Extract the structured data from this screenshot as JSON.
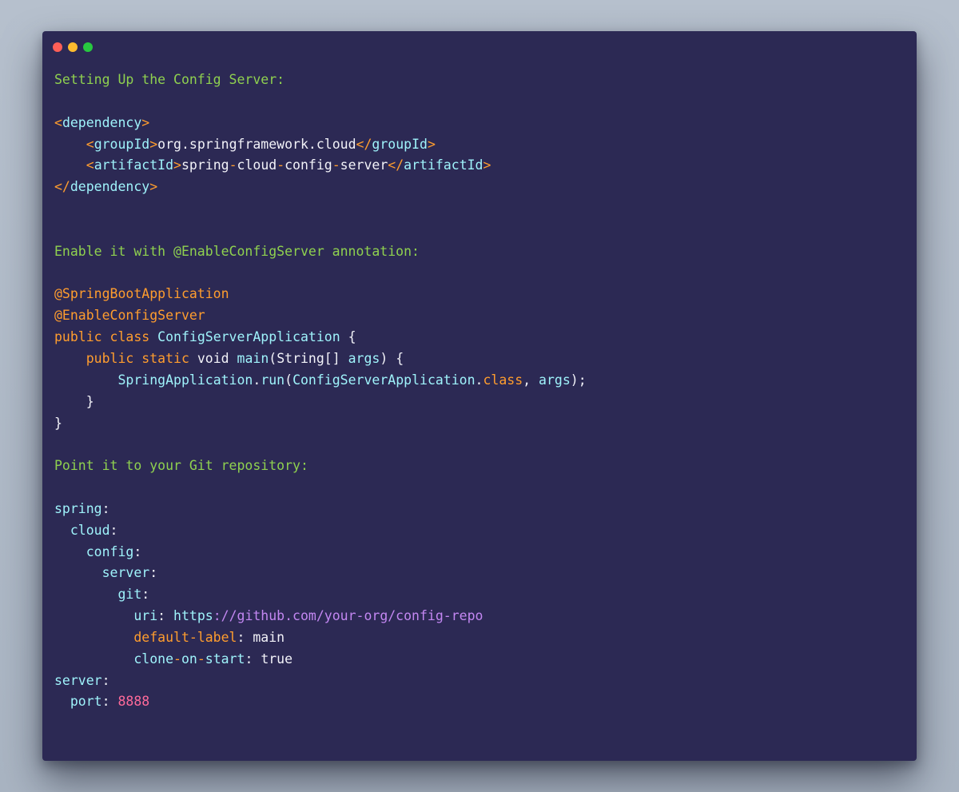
{
  "colors": {
    "background": "#aeb8c6",
    "window": "#2c2954",
    "close_dot": "#ff5f57",
    "minimize_dot": "#febc2e",
    "maximize_dot": "#28c840",
    "comment": "#8fd14f",
    "keyword": "#ff9d2e",
    "identifier": "#9ff3fb",
    "string": "#c387f2",
    "number": "#ff6a9a",
    "plain": "#f2f2f8"
  },
  "window_controls": [
    "close",
    "minimize",
    "maximize"
  ],
  "code_lines": [
    [
      {
        "t": "Setting Up the Config Server:",
        "c": "green"
      }
    ],
    [],
    [
      {
        "t": "<",
        "c": "orange"
      },
      {
        "t": "dependency",
        "c": "cyan"
      },
      {
        "t": ">",
        "c": "orange"
      }
    ],
    [
      {
        "t": "    "
      },
      {
        "t": "<",
        "c": "orange"
      },
      {
        "t": "groupId",
        "c": "cyan"
      },
      {
        "t": ">",
        "c": "orange"
      },
      {
        "t": "org.springframework.cloud",
        "c": "white"
      },
      {
        "t": "</",
        "c": "orange"
      },
      {
        "t": "groupId",
        "c": "cyan"
      },
      {
        "t": ">",
        "c": "orange"
      }
    ],
    [
      {
        "t": "    "
      },
      {
        "t": "<",
        "c": "orange"
      },
      {
        "t": "artifactId",
        "c": "cyan"
      },
      {
        "t": ">",
        "c": "orange"
      },
      {
        "t": "spring",
        "c": "white"
      },
      {
        "t": "-",
        "c": "orange"
      },
      {
        "t": "cloud",
        "c": "white"
      },
      {
        "t": "-",
        "c": "orange"
      },
      {
        "t": "config",
        "c": "white"
      },
      {
        "t": "-",
        "c": "orange"
      },
      {
        "t": "server",
        "c": "white"
      },
      {
        "t": "</",
        "c": "orange"
      },
      {
        "t": "artifactId",
        "c": "cyan"
      },
      {
        "t": ">",
        "c": "orange"
      }
    ],
    [
      {
        "t": "</",
        "c": "orange"
      },
      {
        "t": "dependency",
        "c": "cyan"
      },
      {
        "t": ">",
        "c": "orange"
      }
    ],
    [],
    [],
    [
      {
        "t": "Enable it with @EnableConfigServer annotation:",
        "c": "green"
      }
    ],
    [],
    [
      {
        "t": "@SpringBootApplication",
        "c": "orange"
      }
    ],
    [
      {
        "t": "@EnableConfigServer",
        "c": "orange"
      }
    ],
    [
      {
        "t": "public",
        "c": "orange"
      },
      {
        "t": " "
      },
      {
        "t": "class",
        "c": "orange"
      },
      {
        "t": " "
      },
      {
        "t": "ConfigServerApplication",
        "c": "cyan"
      },
      {
        "t": " {",
        "c": "white"
      }
    ],
    [
      {
        "t": "    "
      },
      {
        "t": "public",
        "c": "orange"
      },
      {
        "t": " "
      },
      {
        "t": "static",
        "c": "orange"
      },
      {
        "t": " void ",
        "c": "white"
      },
      {
        "t": "main",
        "c": "cyan"
      },
      {
        "t": "(String[] ",
        "c": "white"
      },
      {
        "t": "args",
        "c": "cyan"
      },
      {
        "t": ") {",
        "c": "white"
      }
    ],
    [
      {
        "t": "        "
      },
      {
        "t": "SpringApplication",
        "c": "cyan"
      },
      {
        "t": ".",
        "c": "white"
      },
      {
        "t": "run",
        "c": "cyan"
      },
      {
        "t": "(",
        "c": "white"
      },
      {
        "t": "ConfigServerApplication",
        "c": "cyan"
      },
      {
        "t": ".",
        "c": "white"
      },
      {
        "t": "class",
        "c": "orange"
      },
      {
        "t": ", ",
        "c": "white"
      },
      {
        "t": "args",
        "c": "cyan"
      },
      {
        "t": ");",
        "c": "white"
      }
    ],
    [
      {
        "t": "    "
      },
      {
        "t": "}",
        "c": "white"
      }
    ],
    [
      {
        "t": "}",
        "c": "white"
      }
    ],
    [],
    [
      {
        "t": "Point it to your Git repository:",
        "c": "green"
      }
    ],
    [],
    [
      {
        "t": "spring",
        "c": "cyan"
      },
      {
        "t": ":",
        "c": "white"
      }
    ],
    [
      {
        "t": "  "
      },
      {
        "t": "cloud",
        "c": "cyan"
      },
      {
        "t": ":",
        "c": "white"
      }
    ],
    [
      {
        "t": "    "
      },
      {
        "t": "config",
        "c": "cyan"
      },
      {
        "t": ":",
        "c": "white"
      }
    ],
    [
      {
        "t": "      "
      },
      {
        "t": "server",
        "c": "cyan"
      },
      {
        "t": ":",
        "c": "white"
      }
    ],
    [
      {
        "t": "        "
      },
      {
        "t": "git",
        "c": "cyan"
      },
      {
        "t": ":",
        "c": "white"
      }
    ],
    [
      {
        "t": "          "
      },
      {
        "t": "uri",
        "c": "cyan"
      },
      {
        "t": ": ",
        "c": "white"
      },
      {
        "t": "https",
        "c": "cyan"
      },
      {
        "t": "://github.com/your-org/config-repo",
        "c": "purple"
      }
    ],
    [
      {
        "t": "          "
      },
      {
        "t": "default-label",
        "c": "orange"
      },
      {
        "t": ": ",
        "c": "white"
      },
      {
        "t": "main",
        "c": "white"
      }
    ],
    [
      {
        "t": "          "
      },
      {
        "t": "clone",
        "c": "cyan"
      },
      {
        "t": "-",
        "c": "orange"
      },
      {
        "t": "on",
        "c": "cyan"
      },
      {
        "t": "-",
        "c": "orange"
      },
      {
        "t": "start",
        "c": "cyan"
      },
      {
        "t": ": ",
        "c": "white"
      },
      {
        "t": "true",
        "c": "white"
      }
    ],
    [
      {
        "t": "server",
        "c": "cyan"
      },
      {
        "t": ":",
        "c": "white"
      }
    ],
    [
      {
        "t": "  "
      },
      {
        "t": "port",
        "c": "cyan"
      },
      {
        "t": ": ",
        "c": "white"
      },
      {
        "t": "8888",
        "c": "pink"
      }
    ]
  ]
}
